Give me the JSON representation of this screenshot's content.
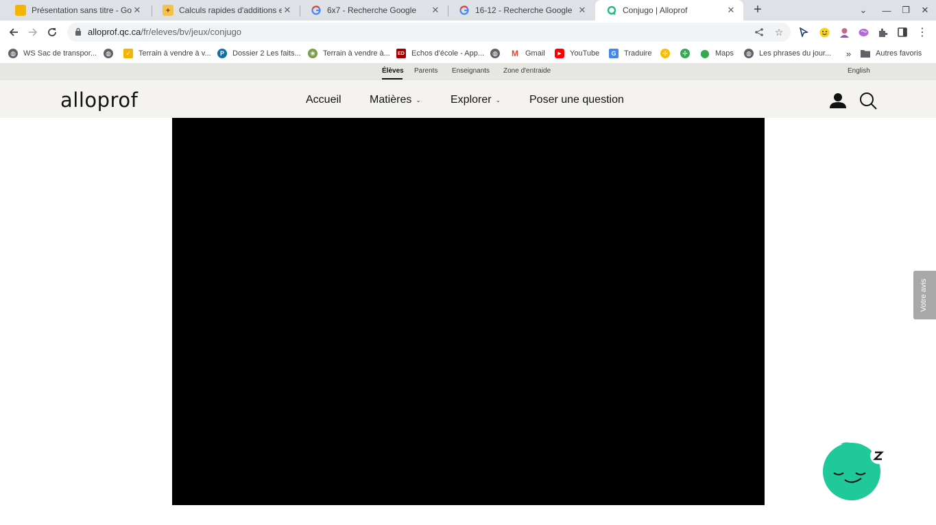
{
  "tabs": [
    {
      "title": "Présentation sans titre - Google S",
      "icon": "google-slides-icon",
      "color": "#f4b400"
    },
    {
      "title": "Calculs rapides d'additions et de",
      "icon": "games-icon",
      "color": "#e8a33c"
    },
    {
      "title": "6x7 - Recherche Google",
      "icon": "google-icon",
      "color": "#4285f4"
    },
    {
      "title": "16-12 - Recherche Google",
      "icon": "google-icon",
      "color": "#4285f4"
    },
    {
      "title": "Conjugo | Alloprof",
      "icon": "alloprof-icon",
      "color": "#1fb88c"
    }
  ],
  "new_tab": "+",
  "address": {
    "host": "alloprof.qc.ca",
    "path": "/fr/eleves/bv/jeux/conjugo"
  },
  "bookmarks": [
    {
      "label": "WS Sac de transpor...",
      "icon": "globe-icon",
      "color": "#5f6368"
    },
    {
      "label": "",
      "icon": "globe-icon",
      "color": "#5f6368"
    },
    {
      "label": "Terrain à vendre à v...",
      "icon": "checkbox-icon",
      "color": "#f4b400"
    },
    {
      "label": "Dossier 2 Les faits...",
      "icon": "pinterest-icon",
      "color": "#0f6fa8"
    },
    {
      "label": "Terrain à vendre à...",
      "icon": "leaf-icon",
      "color": "#7a9e4a"
    },
    {
      "label": "Echos d'école - App...",
      "icon": "ed-icon",
      "color": "#a00000"
    },
    {
      "label": "",
      "icon": "globe-icon",
      "color": "#5f6368"
    },
    {
      "label": "Gmail",
      "icon": "gmail-icon",
      "color": "#ea4335"
    },
    {
      "label": "YouTube",
      "icon": "youtube-icon",
      "color": "#ff0000"
    },
    {
      "label": "Traduire",
      "icon": "translate-icon",
      "color": "#4285f4"
    },
    {
      "label": "",
      "icon": "pinwheel-icon",
      "color": "#fbbc04"
    },
    {
      "label": "",
      "icon": "pinwheel-icon",
      "color": "#34a853"
    },
    {
      "label": "Maps",
      "icon": "maps-pin-icon",
      "color": "#34a853"
    },
    {
      "label": "Les phrases du jour...",
      "icon": "globe-icon",
      "color": "#5f6368"
    }
  ],
  "bookmarks_overflow": "»",
  "other_bookmarks": "Autres favoris",
  "audience": {
    "students": "Élèves",
    "parents": "Parents",
    "teachers": "Enseignants",
    "help_zone": "Zone d'entraide",
    "language": "English"
  },
  "site": {
    "logo": "alloprof",
    "nav": {
      "home": "Accueil",
      "subjects": "Matières",
      "explore": "Explorer",
      "ask": "Poser une question"
    }
  },
  "feedback": "Votre avis",
  "colors": {
    "brand_green": "#1fc99a",
    "nav_bg": "#f4f3ef",
    "audience_bg": "#e6e6e3"
  }
}
